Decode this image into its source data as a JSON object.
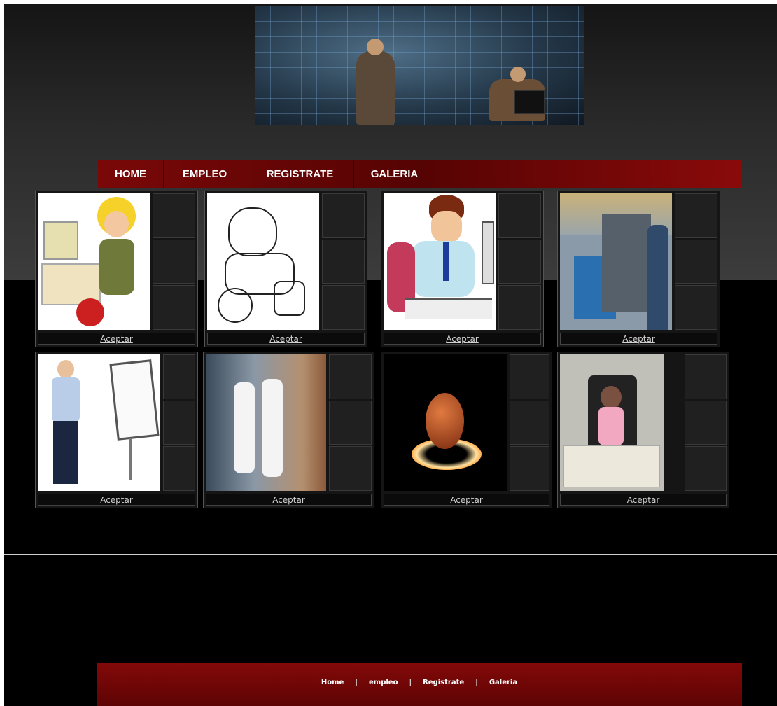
{
  "nav": {
    "items": [
      "HOME",
      "EMPLEO",
      "REGISTRATE",
      "GALERIA"
    ]
  },
  "cards": [
    {
      "accept": "Aceptar",
      "photo": "woman-on-phone-at-computer",
      "info": [
        "",
        "",
        ""
      ]
    },
    {
      "accept": "Aceptar",
      "photo": "mechanic-sketch",
      "info": [
        "",
        "",
        ""
      ]
    },
    {
      "accept": "Aceptar",
      "photo": "man-at-desk-computer",
      "info": [
        "",
        "",
        ""
      ]
    },
    {
      "accept": "Aceptar",
      "photo": "factory-worker",
      "info": [
        "",
        "",
        ""
      ]
    },
    {
      "accept": "Aceptar",
      "photo": "guard-with-chart",
      "info": [
        "",
        "",
        ""
      ]
    },
    {
      "accept": "Aceptar",
      "photo": "nurses-hallway",
      "info": [
        "",
        "",
        ""
      ]
    },
    {
      "accept": "Aceptar",
      "photo": "glowing-ball",
      "info": [
        "",
        "",
        ""
      ]
    },
    {
      "accept": "Aceptar",
      "photo": "receptionist-kiosk",
      "info": [
        "",
        "",
        ""
      ]
    }
  ],
  "footer": {
    "links": [
      "Home",
      "empleo",
      "Registrate",
      "Galeria"
    ],
    "separator": "|"
  },
  "colors": {
    "nav_bg": "#6a0505",
    "footer_bg": "#760707",
    "page_bg": "#000000"
  }
}
